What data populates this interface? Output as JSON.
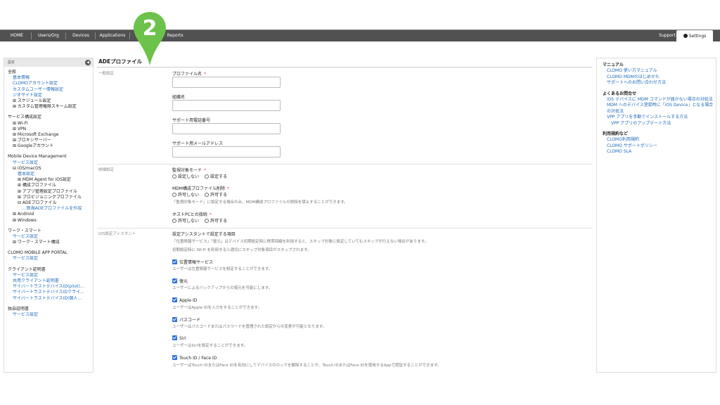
{
  "nav": {
    "items": [
      "HOME",
      "Users/Org",
      "Devices",
      "Applications",
      "Reports"
    ],
    "support": "Support",
    "settings": "Settings"
  },
  "marker": {
    "number": "2",
    "color": "#6cc24a"
  },
  "sidebar": {
    "header": "設定",
    "lines": [
      {
        "text": "全般",
        "kind": "sec"
      },
      {
        "text": "基本情報",
        "kind": "link",
        "indent": 1
      },
      {
        "text": "CLOMOアカウント設定",
        "kind": "link",
        "indent": 1
      },
      {
        "text": "カスタムユーザー情報設定",
        "kind": "link",
        "indent": 1
      },
      {
        "text": "ジオサイト設定",
        "kind": "link",
        "indent": 1
      },
      {
        "text": "⊞ スケジュール設定",
        "kind": "plain",
        "indent": 1
      },
      {
        "text": "⊞ カスタム管理権限スキーム設定",
        "kind": "plain",
        "indent": 1
      },
      {
        "text": "",
        "kind": "gap"
      },
      {
        "text": "サービス構成設定",
        "kind": "sec"
      },
      {
        "text": "⊞ Wi-Fi",
        "kind": "plain",
        "indent": 1
      },
      {
        "text": "⊞ VPN",
        "kind": "plain",
        "indent": 1
      },
      {
        "text": "⊞ Microsoft Exchange",
        "kind": "plain",
        "indent": 1
      },
      {
        "text": "⊞ プロキシサーバー",
        "kind": "plain",
        "indent": 1
      },
      {
        "text": "⊞ Googleアカウント",
        "kind": "plain",
        "indent": 1
      },
      {
        "text": "",
        "kind": "gap"
      },
      {
        "text": "Mobile Device Management",
        "kind": "sec"
      },
      {
        "text": "サービス設定",
        "kind": "link",
        "indent": 1
      },
      {
        "text": "⊟ iOS/macOS",
        "kind": "plain",
        "indent": 1
      },
      {
        "text": "基本設定",
        "kind": "link",
        "indent": 2
      },
      {
        "text": "⊞ MDM Agent for iOS設定",
        "kind": "plain",
        "indent": 2
      },
      {
        "text": "⊞ 構成プロファイル",
        "kind": "plain",
        "indent": 2
      },
      {
        "text": "⊞ アプリ管理設定プロファイル",
        "kind": "plain",
        "indent": 2
      },
      {
        "text": "⊞ プロビジョニングプロファイル",
        "kind": "plain",
        "indent": 2
      },
      {
        "text": "⊟ ADEプロファイル",
        "kind": "plain",
        "indent": 2
      },
      {
        "text": "...新規ADEプロファイルを作成",
        "kind": "link",
        "indent": 3
      },
      {
        "text": "⊞ Android",
        "kind": "plain",
        "indent": 1
      },
      {
        "text": "⊞ Windows",
        "kind": "plain",
        "indent": 1
      },
      {
        "text": "",
        "kind": "gap"
      },
      {
        "text": "ワーク・スマート",
        "kind": "sec"
      },
      {
        "text": "サービス設定",
        "kind": "link",
        "indent": 1
      },
      {
        "text": "⊞ ワーク・スマート構成",
        "kind": "plain",
        "indent": 1
      },
      {
        "text": "",
        "kind": "gap"
      },
      {
        "text": "CLOMO MOBILE APP PORTAL",
        "kind": "sec"
      },
      {
        "text": "サービス設定",
        "kind": "link",
        "indent": 1
      },
      {
        "text": "",
        "kind": "gap"
      },
      {
        "text": "クライアント証明書",
        "kind": "sec"
      },
      {
        "text": "サービス設定",
        "kind": "link",
        "indent": 1
      },
      {
        "text": "共用クライアント証明書",
        "kind": "link",
        "indent": 1
      },
      {
        "text": "サイバートラストデバイスID(pilot)...",
        "kind": "link",
        "indent": 1
      },
      {
        "text": "サイバートラストデバイスIDクライ...",
        "kind": "link",
        "indent": 1
      },
      {
        "text": "サイバートラストデバイスID(個人...",
        "kind": "link",
        "indent": 1
      },
      {
        "text": "",
        "kind": "gap"
      },
      {
        "text": "独自証明書",
        "kind": "sec"
      },
      {
        "text": "サービス設定",
        "kind": "link",
        "indent": 1
      }
    ]
  },
  "main": {
    "title": "ADEプロファイル",
    "general": {
      "label": "一般設定",
      "profile_name": "プロファイル名",
      "org_name": "組織名",
      "support_phone": "サポート用電話番号",
      "support_email": "サポート用メールアドレス"
    },
    "detail": {
      "label": "詳細設定",
      "supervised": "監視対象モード",
      "supervised_opts": [
        "設定しない",
        "設定する"
      ],
      "mdm_remove": "MDM構成プロファイル削除",
      "mdm_remove_opts": [
        "許可しない",
        "許可する"
      ],
      "mdm_note": "「監視対象モード」に設定する場合のみ、MDM構成プロファイルの削除を禁止することができます。",
      "host_pc": "ホストPCとの接続",
      "host_pc_opts": [
        "許可しない",
        "許可する"
      ]
    },
    "assistant": {
      "label": "iOS設定アシスタント",
      "heading": "設定アシスタントで設定する項目",
      "note1": "「位置情報サービス」「復元」はデバイス初期設定時に携帯回線を利用すると、スキップ対象に設定していてもスキップが行えない場合があります。",
      "note2": "初期設定時に Wi-Fi を利用すると適切にスキップ対象項目がスキップされます。",
      "items": [
        {
          "label": "位置情報サービス",
          "desc": "ユーザーは位置情報サービスを設定することができます。"
        },
        {
          "label": "復元",
          "desc": "ユーザーによるバックアップからの復元を可能にします。"
        },
        {
          "label": "Apple ID",
          "desc": "ユーザーはApple IDを入力をすることができます。"
        },
        {
          "label": "パスコード",
          "desc": "ユーザーはパスコードまたはパスワードを管理された設定からの変更が可能となります。"
        },
        {
          "label": "Siri",
          "desc": "ユーザーはSiriを設定することができます。"
        },
        {
          "label": "Touch ID / Face ID",
          "desc": "ユーザーはTouch IDまたはFace IDを有効にしてデバイスのロックを解除することや、Touch IDまたはFace IDを使用するAppで認証することができます。"
        }
      ]
    }
  },
  "right": {
    "manual_head": "マニュアル",
    "manual_links": [
      "CLOMO 使い方マニュアル",
      "CLOMO MDMのはじめかた",
      "サポートへのお問い合わせ方法"
    ],
    "faq_head": "よくあるお問合せ",
    "faq_links": [
      {
        "text": "iOS デバイスに MDM コマンドが届かない場合の対処法",
        "indent": 0
      },
      {
        "text": "MDM へのデバイス登録時に「iOS Device」となる場合の対処法",
        "indent": 0
      },
      {
        "text": "VPP アプリを手動でインストールする方法",
        "indent": 0
      },
      {
        "text": "VPP アプリのアップデート方法",
        "indent": 1
      }
    ],
    "terms_head": "利用規約など",
    "terms_links": [
      "CLOMO利用規約",
      "CLOMO サポートポリシー",
      "CLOMO SLA"
    ]
  }
}
